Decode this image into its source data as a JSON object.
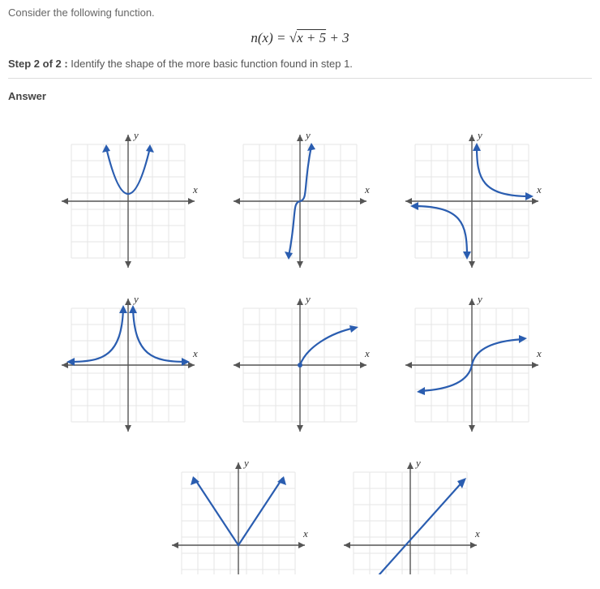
{
  "question": {
    "prompt": "Consider the following function.",
    "formula_lhs": "n(x) = ",
    "formula_sqrt_arg": "x + 5",
    "formula_tail": " + 3",
    "step_label": "Step 2 of 2 :",
    "step_text": " Identify the shape of the more basic function found in step 1."
  },
  "answer_label": "Answer",
  "axes": {
    "x": "x",
    "y": "y"
  },
  "chart_data": [
    {
      "type": "parabola",
      "desc": "y = x^2"
    },
    {
      "type": "cubic",
      "desc": "y = x^3"
    },
    {
      "type": "reciprocal",
      "desc": "y = 1/x"
    },
    {
      "type": "reciprocal-squared",
      "desc": "y = 1/x^2"
    },
    {
      "type": "sqrt",
      "desc": "y = sqrt(x)"
    },
    {
      "type": "cbrt",
      "desc": "y = cbrt(x)"
    },
    {
      "type": "abs",
      "desc": "y = |x|"
    },
    {
      "type": "linear",
      "desc": "y = x"
    }
  ]
}
